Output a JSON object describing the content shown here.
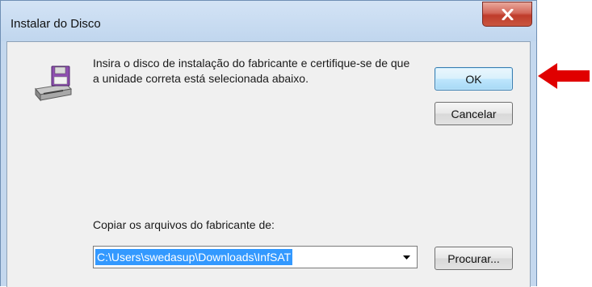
{
  "dialog": {
    "title": "Instalar do Disco",
    "message": "Insira o disco de instalação do fabricante e certifique-se de que a unidade correta está selecionada abaixo.",
    "ok_label": "OK",
    "cancel_label": "Cancelar",
    "copy_label": "Copiar os arquivos do fabricante de:",
    "path_value": "C:\\Users\\swedasup\\Downloads\\InfSAT",
    "browse_label": "Procurar..."
  },
  "icons": {
    "close": "close-icon",
    "disk": "floppy-disk-drive-icon",
    "dropdown": "chevron-down-icon",
    "annotation": "red-arrow-icon"
  },
  "colors": {
    "title_bar": "#c4d8ee",
    "close_button": "#c9463a",
    "selection": "#3399ff",
    "annotation_arrow": "#e00000"
  }
}
